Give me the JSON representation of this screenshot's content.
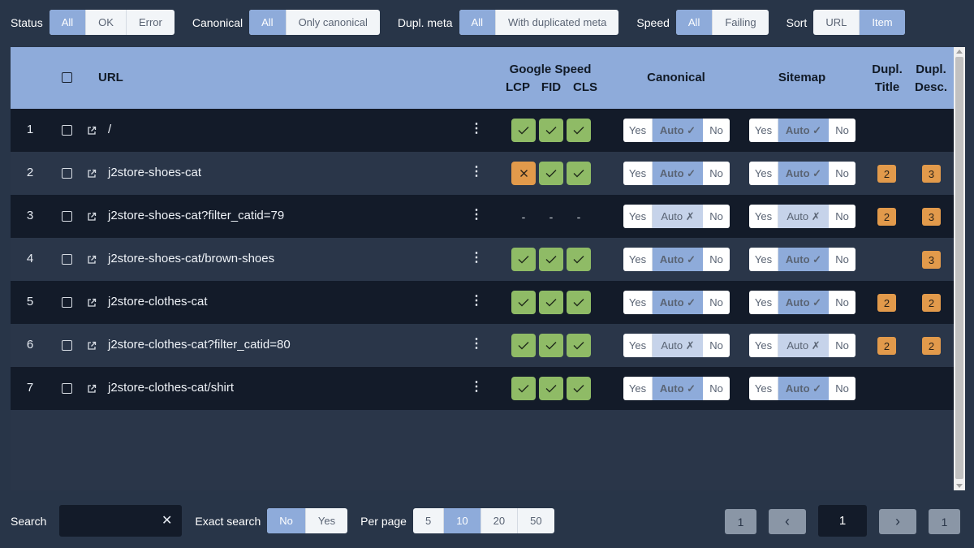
{
  "filters": [
    {
      "label": "Status",
      "options": [
        "All",
        "OK",
        "Error"
      ],
      "active": 0
    },
    {
      "label": "Canonical",
      "options": [
        "All",
        "Only canonical"
      ],
      "active": 0
    },
    {
      "label": "Dupl. meta",
      "options": [
        "All",
        "With duplicated meta"
      ],
      "active": 0
    },
    {
      "label": "Speed",
      "options": [
        "All",
        "Failing"
      ],
      "active": 0
    },
    {
      "label": "Sort",
      "options": [
        "URL",
        "Item"
      ],
      "active": 1
    }
  ],
  "table": {
    "headers": {
      "url": "URL",
      "speed": "Google Speed",
      "lcp": "LCP",
      "fid": "FID",
      "cls": "CLS",
      "canonical": "Canonical",
      "sitemap": "Sitemap",
      "dupl_title_1": "Dupl.",
      "dupl_title_2": "Title",
      "dupl_desc_1": "Dupl.",
      "dupl_desc_2": "Desc."
    },
    "toggle_labels": {
      "yes": "Yes",
      "auto": "Auto",
      "no": "No",
      "check": "✓",
      "cross": "✗"
    },
    "rows": [
      {
        "num": "1",
        "url": "/",
        "speed": [
          "ok",
          "ok",
          "ok"
        ],
        "canonical_auto": true,
        "sitemap_auto": true,
        "dupl_title": "",
        "dupl_desc": "",
        "shade": "dark"
      },
      {
        "num": "2",
        "url": "j2store-shoes-cat",
        "speed": [
          "bad",
          "ok",
          "ok"
        ],
        "canonical_auto": true,
        "sitemap_auto": true,
        "dupl_title": "2",
        "dupl_desc": "3",
        "shade": "light"
      },
      {
        "num": "3",
        "url": "j2store-shoes-cat?filter_catid=79",
        "speed": [
          "none",
          "none",
          "none"
        ],
        "canonical_auto": false,
        "sitemap_auto": false,
        "dupl_title": "2",
        "dupl_desc": "3",
        "shade": "dark"
      },
      {
        "num": "4",
        "url": "j2store-shoes-cat/brown-shoes",
        "speed": [
          "ok",
          "ok",
          "ok"
        ],
        "canonical_auto": true,
        "sitemap_auto": true,
        "dupl_title": "",
        "dupl_desc": "3",
        "shade": "light"
      },
      {
        "num": "5",
        "url": "j2store-clothes-cat",
        "speed": [
          "ok",
          "ok",
          "ok"
        ],
        "canonical_auto": true,
        "sitemap_auto": true,
        "dupl_title": "2",
        "dupl_desc": "2",
        "shade": "dark"
      },
      {
        "num": "6",
        "url": "j2store-clothes-cat?filter_catid=80",
        "speed": [
          "ok",
          "ok",
          "ok"
        ],
        "canonical_auto": false,
        "sitemap_auto": false,
        "dupl_title": "2",
        "dupl_desc": "2",
        "shade": "light"
      },
      {
        "num": "7",
        "url": "j2store-clothes-cat/shirt",
        "speed": [
          "ok",
          "ok",
          "ok"
        ],
        "canonical_auto": true,
        "sitemap_auto": true,
        "dupl_title": "",
        "dupl_desc": "",
        "shade": "dark"
      }
    ],
    "no_value": "-"
  },
  "footer": {
    "search_label": "Search",
    "search_value": "",
    "clear_glyph": "✕",
    "exact_label": "Exact search",
    "exact_options": [
      "No",
      "Yes"
    ],
    "exact_active": 0,
    "perpage_label": "Per page",
    "perpage_options": [
      "5",
      "10",
      "20",
      "50"
    ],
    "perpage_active": 1
  },
  "pagination": {
    "first": "1",
    "prev": "‹",
    "current": "1",
    "next": "›",
    "last": "1"
  },
  "colors": {
    "accent": "#8eabda",
    "ok": "#8fbb66",
    "warn": "#e29a4b",
    "bg": "#283548"
  }
}
